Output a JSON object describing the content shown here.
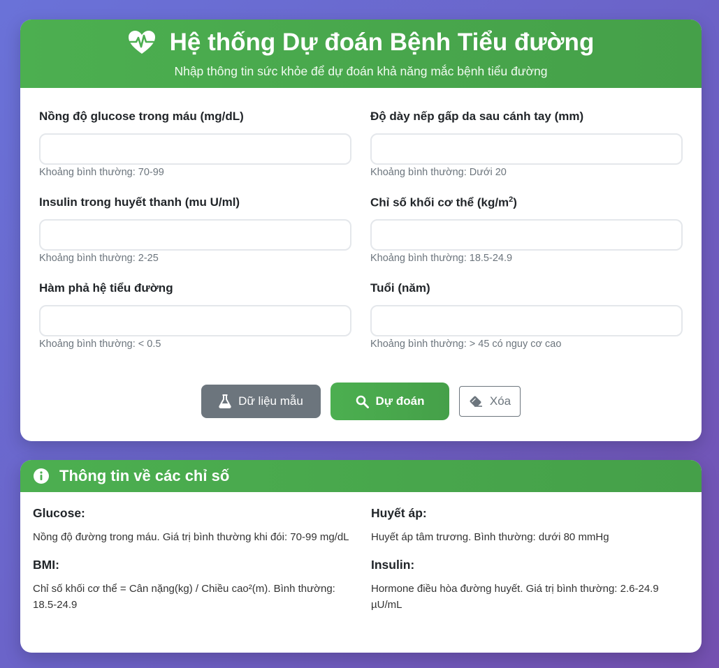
{
  "header": {
    "title": "Hệ thống Dự đoán Bệnh Tiểu đường",
    "subtitle": "Nhập thông tin sức khỏe để dự đoán khả năng mắc bệnh tiểu đường",
    "icon": "heart-pulse-icon"
  },
  "fields": [
    {
      "label": "Nồng độ glucose trong máu (mg/dL)",
      "value": "",
      "placeholder": "",
      "hint": "Khoảng bình thường: 70-99"
    },
    {
      "label": "Độ dày nếp gấp da sau cánh tay (mm)",
      "value": "",
      "placeholder": "",
      "hint": "Khoảng bình thường: Dưới 20"
    },
    {
      "label": "Insulin trong huyết thanh (mu U/ml)",
      "value": "",
      "placeholder": "",
      "hint": "Khoảng bình thường: 2-25"
    },
    {
      "label_prefix": "Chỉ số khối cơ thể (kg/m",
      "label_sup": "2",
      "label_suffix": ")",
      "value": "",
      "placeholder": "",
      "hint": "Khoảng bình thường: 18.5-24.9"
    },
    {
      "label": "Hàm phả hệ tiểu đường",
      "value": "",
      "placeholder": "",
      "hint": "Khoảng bình thường: < 0.5"
    },
    {
      "label": "Tuổi (năm)",
      "value": "",
      "placeholder": "",
      "hint": "Khoảng bình thường: > 45 có nguy cơ cao"
    }
  ],
  "buttons": {
    "sample": "Dữ liệu mẫu",
    "predict": "Dự đoán",
    "clear": "Xóa"
  },
  "info": {
    "title": "Thông tin về các chỉ số",
    "icon": "info-circle-icon",
    "glucose_title": "Glucose:",
    "glucose_text": "Nồng độ đường trong máu. Giá trị bình thường khi đói: 70-99 mg/dL",
    "bmi_title": "BMI:",
    "bmi_text": "Chỉ số khối cơ thể = Cân nặng(kg) / Chiều cao²(m). Bình thường: 18.5-24.9",
    "bp_title": "Huyết áp:",
    "bp_text": "Huyết áp tâm trương. Bình thường: dưới 80 mmHg",
    "insulin_title": "Insulin:",
    "insulin_text": "Hormone điều hòa đường huyết. Giá trị bình thường: 2.6-24.9 µU/mL"
  },
  "colors": {
    "accent": "#4caf50",
    "secondary": "#6c757d",
    "background": "#6a72d8"
  }
}
